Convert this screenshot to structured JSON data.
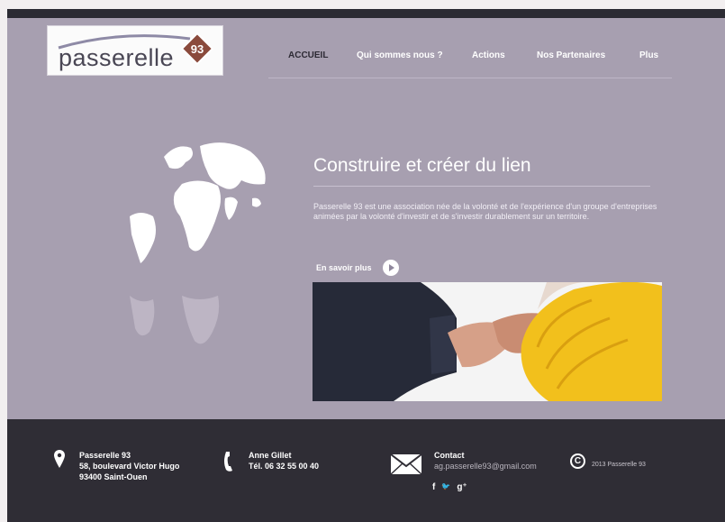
{
  "logo": {
    "text": "passerelle",
    "badge": "93"
  },
  "nav": {
    "items": [
      {
        "label": "ACCUEIL",
        "active": true
      },
      {
        "label": "Qui sommes nous ?",
        "active": false
      },
      {
        "label": "Actions",
        "active": false
      },
      {
        "label": "Nos Partenaires",
        "active": false
      },
      {
        "label": "Plus",
        "active": false
      }
    ]
  },
  "hero": {
    "title": "Construire et créer du lien",
    "text": "Passerelle 93 est une association née de la volonté et de l'expérience d'un groupe d'entreprises animées par la volonté d'investir et de s'investir durablement sur un territoire.",
    "more_label": "En savoir plus"
  },
  "footer": {
    "address": {
      "name": "Passerelle 93",
      "street": "58, boulevard Victor Hugo",
      "city": "93400 Saint-Ouen"
    },
    "phone": {
      "name": "Anne Gillet",
      "number": "Tél. 06 32 55 00 40"
    },
    "contact": {
      "label": "Contact",
      "email": "ag.passerelle93@gmail.com"
    },
    "social": {
      "facebook": "f",
      "twitter": "🐦",
      "googleplus": "g⁺"
    },
    "copyright": "2013 Passerelle 93"
  },
  "colors": {
    "background": "#a79fb0",
    "footer": "#2f2d35",
    "logo_badge": "#8a4a3c"
  },
  "icons": [
    "map-pin-icon",
    "phone-icon",
    "envelope-icon",
    "copyright-icon",
    "play-icon",
    "globe-icon"
  ]
}
